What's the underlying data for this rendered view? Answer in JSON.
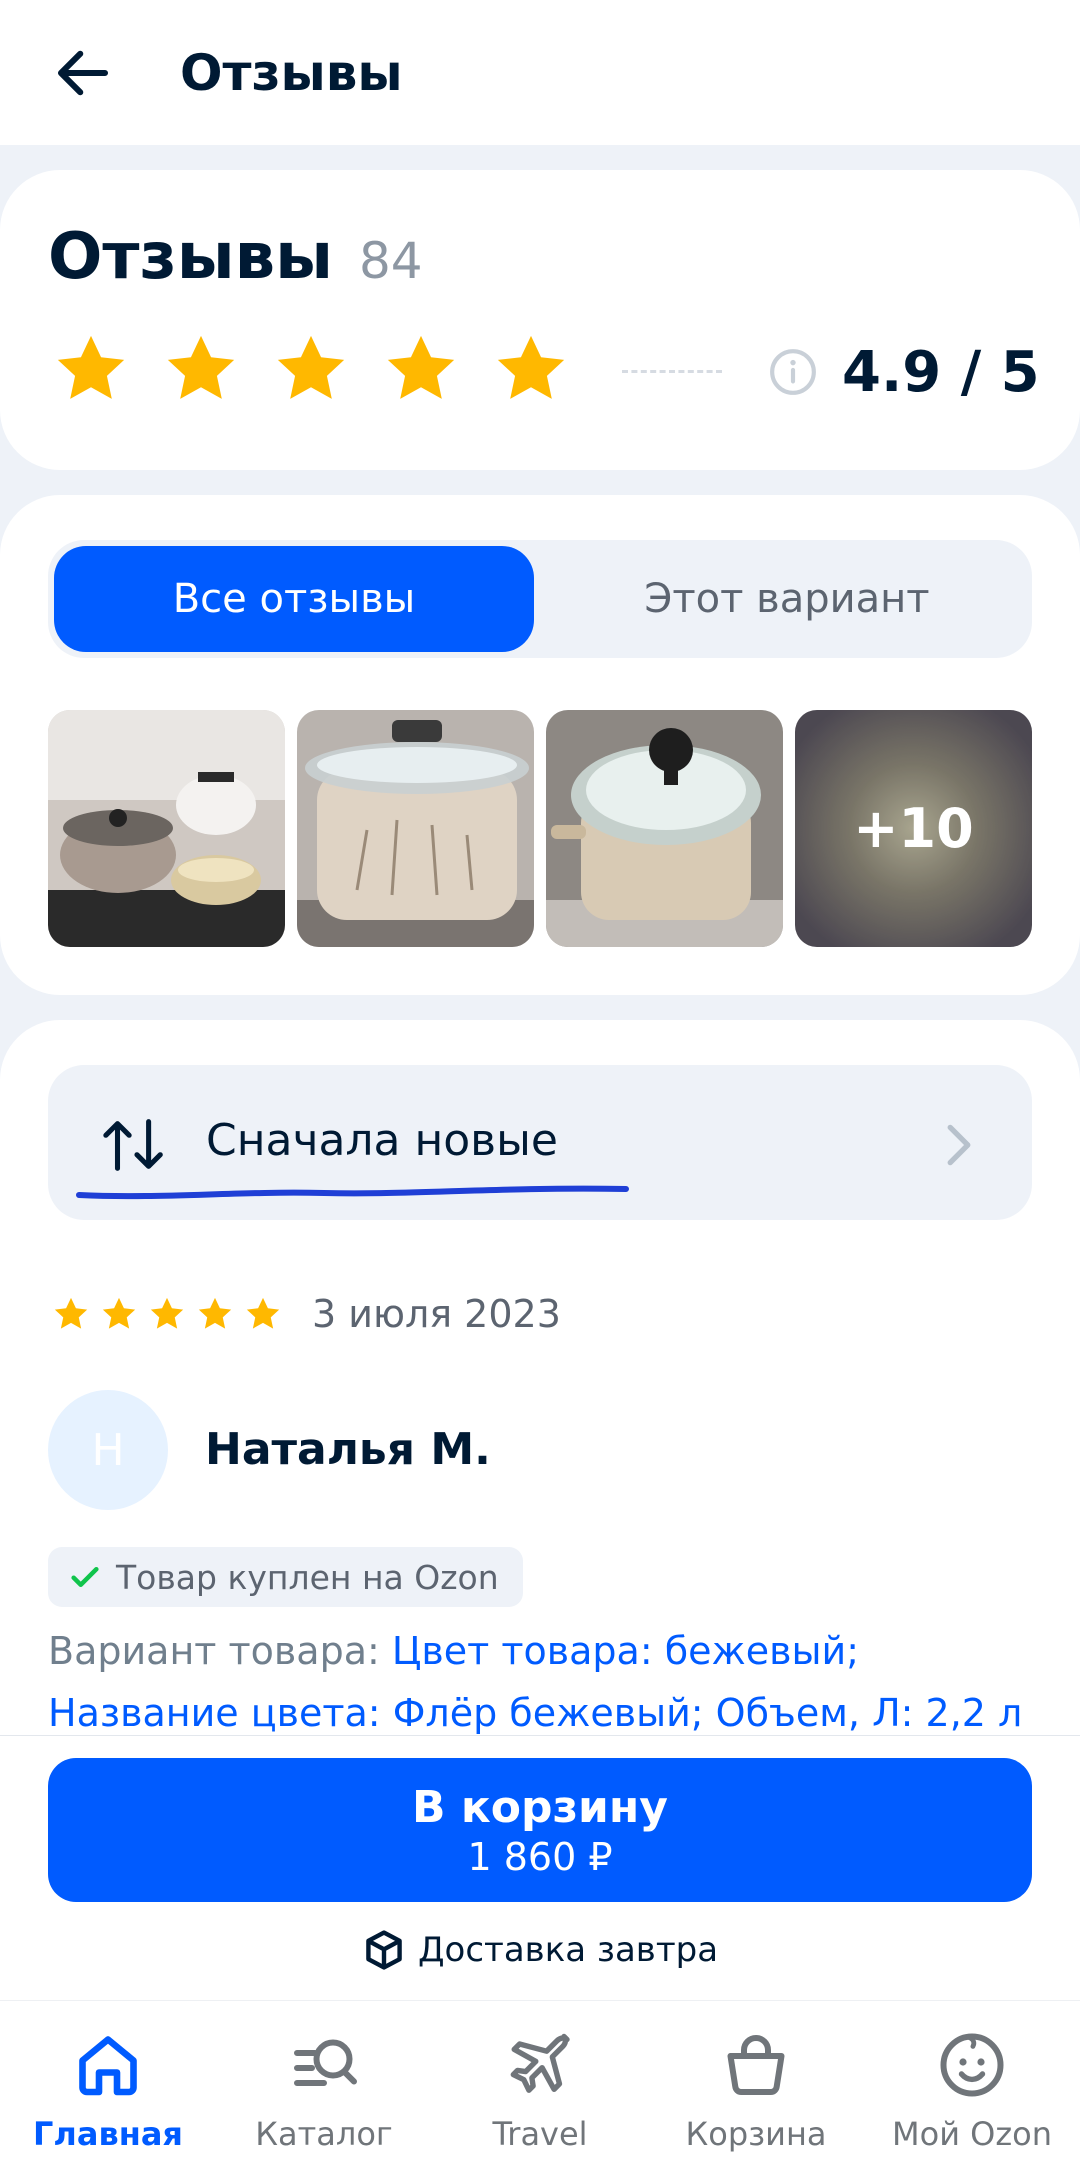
{
  "appbar": {
    "title": "Отзывы",
    "back_icon": "arrow-left-icon"
  },
  "summary": {
    "heading": "Отзывы",
    "count": "84",
    "stars_filled": 5,
    "stars_total": 5,
    "rating": "4.9 / 5",
    "star_color": "#ffb800"
  },
  "tabs": {
    "all": "Все отзывы",
    "variant": "Этот вариант",
    "active": "all"
  },
  "photos": {
    "more_label": "+10"
  },
  "sort": {
    "label": "Сначала новые"
  },
  "review": {
    "stars_filled": 5,
    "date": "3 июля 2023",
    "avatar_letter": "Н",
    "author": "Наталья М.",
    "bought_badge": "Товар куплен на Ozon",
    "variant_prefix": "Вариант товара: ",
    "variant_value": "Цвет товара: бежевый; Название цвета: Флёр бежевый; Объем, Л: 2,2 л"
  },
  "buy": {
    "button_label": "В корзину",
    "price": "1 860 ₽",
    "delivery": "Доставка завтра"
  },
  "nav": {
    "items": [
      {
        "label": "Главная",
        "icon": "home-icon",
        "active": true
      },
      {
        "label": "Каталог",
        "icon": "catalog-search-icon",
        "active": false
      },
      {
        "label": "Travel",
        "icon": "plane-icon",
        "active": false
      },
      {
        "label": "Корзина",
        "icon": "basket-icon",
        "active": false
      },
      {
        "label": "Мой Ozon",
        "icon": "smiley-icon",
        "active": false
      }
    ]
  },
  "colors": {
    "accent": "#005bff",
    "text": "#001a34",
    "muted": "#5c6470",
    "background": "#eef2f8"
  }
}
